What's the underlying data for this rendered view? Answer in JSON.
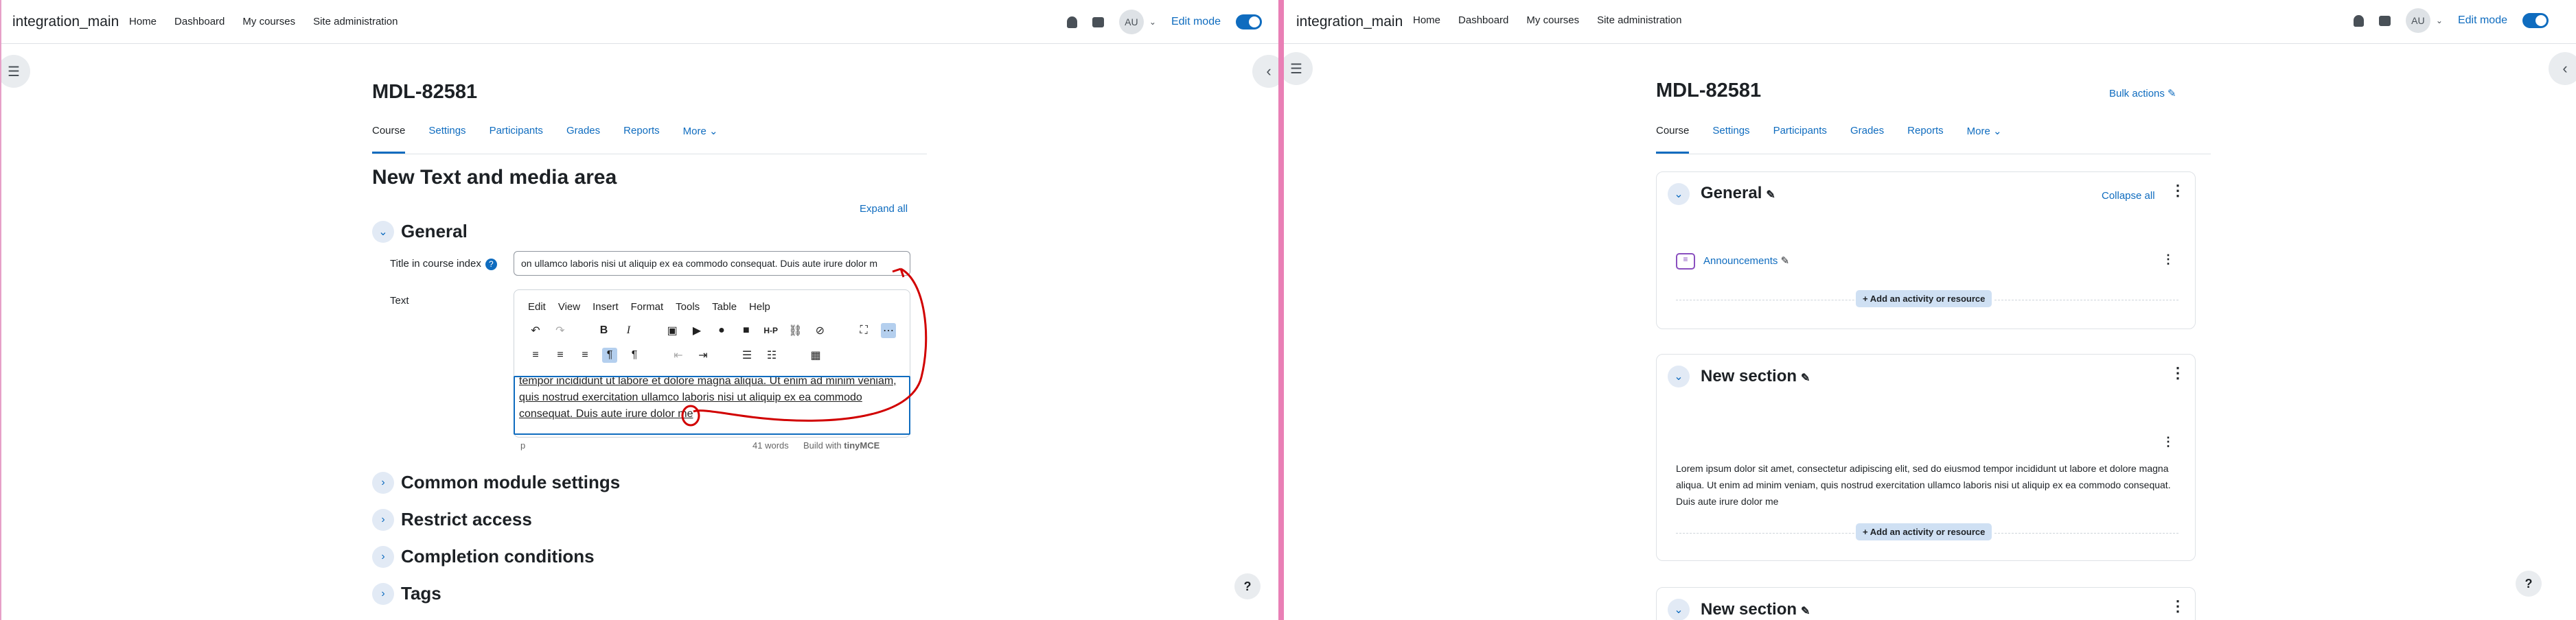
{
  "app": {
    "brand": "integration_main",
    "nav": [
      "Home",
      "Dashboard",
      "My courses",
      "Site administration"
    ],
    "avatar": "AU",
    "edit_mode_label": "Edit mode",
    "accent": "#0f6cbf"
  },
  "course": {
    "title": "MDL-82581",
    "tabs": [
      "Course",
      "Settings",
      "Participants",
      "Grades",
      "Reports",
      "More"
    ]
  },
  "left": {
    "page_heading": "New Text and media area",
    "expand_all": "Expand all",
    "general_heading": "General",
    "title_label": "Title in course index",
    "title_value": "on ullamco laboris nisi ut aliquip ex ea commodo consequat. Duis aute irure dolor m",
    "text_label": "Text",
    "menu": [
      "Edit",
      "View",
      "Insert",
      "Format",
      "Tools",
      "Table",
      "Help"
    ],
    "editor_lines": [
      "tempor incididunt ut labore et dolore magna aliqua. Ut enim ad minim veniam,",
      "quis nostrud exercitation ullamco laboris nisi ut aliquip ex ea commodo",
      "consequat. Duis aute irure dolor me"
    ],
    "status_path": "p",
    "word_count": "41 words",
    "built_with": "Build with",
    "tinymce": "tinyMCE",
    "sections": [
      "Common module settings",
      "Restrict access",
      "Completion conditions",
      "Tags"
    ],
    "annotation_color": "#d10000"
  },
  "right": {
    "bulk_actions": "Bulk actions",
    "general_heading": "General",
    "collapse_all": "Collapse all",
    "announcements": "Announcements",
    "add_activity": "Add an activity or resource",
    "new_section_1": "New section",
    "summary": "Lorem ipsum dolor sit amet, consectetur adipiscing elit, sed do eiusmod tempor incididunt ut labore et dolore magna aliqua. Ut enim ad minim veniam, quis nostrud exercitation ullamco laboris nisi ut aliquip ex ea commodo consequat. Duis aute irure dolor me",
    "new_section_2": "New section"
  },
  "icons": {
    "drawer": "course-index-icon",
    "help": "help-icon",
    "pencil": "pencil-icon",
    "kebab": "kebab-icon"
  }
}
